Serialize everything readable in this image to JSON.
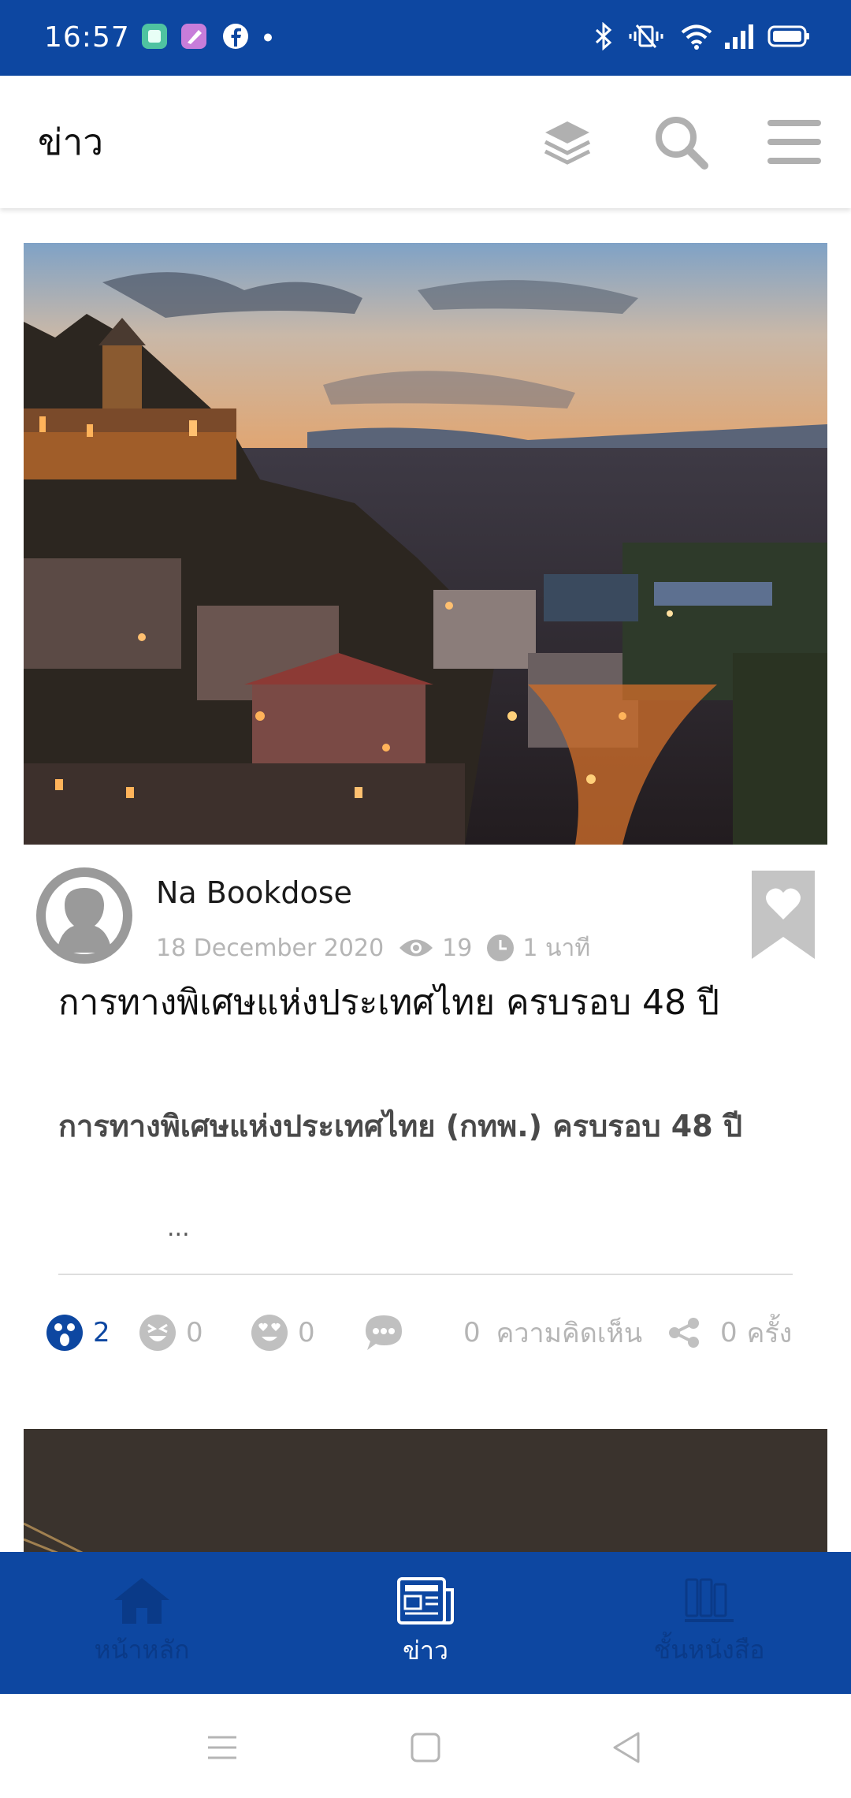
{
  "status_bar": {
    "time": "16:57",
    "icons_left": [
      "app-icon-green",
      "app-icon-pink",
      "facebook-icon",
      "dot-icon"
    ],
    "icons_right": [
      "bluetooth-icon",
      "vibrate-icon",
      "wifi-icon",
      "signal-icon",
      "battery-icon"
    ]
  },
  "app_bar": {
    "title": "ข่าว",
    "actions": [
      "layers-icon",
      "search-icon",
      "menu-icon"
    ]
  },
  "post": {
    "author": "Na Bookdose",
    "date": "18 December 2020",
    "views": "19",
    "read_time": "1 นาที",
    "headline": "การทางพิเศษแห่งประเทศไทย ครบรอบ 48 ปี",
    "subheadline": "การทางพิเศษแห่งประเทศไทย (กทพ.) ครบรอบ 48 ปี",
    "excerpt": "...",
    "reactions": [
      {
        "icon": "wow-icon",
        "count": "2",
        "active": true
      },
      {
        "icon": "laugh-icon",
        "count": "0",
        "active": false
      },
      {
        "icon": "love-icon",
        "count": "0",
        "active": false
      }
    ],
    "comments_count": "0",
    "comments_label": "ความคิดเห็น",
    "shares_count": "0",
    "shares_label": "ครั้ง"
  },
  "bottom_nav": [
    {
      "label": "หน้าหลัก",
      "icon": "home-icon",
      "active": false
    },
    {
      "label": "ข่าว",
      "icon": "news-icon",
      "active": true
    },
    {
      "label": "ชั้นหนังสือ",
      "icon": "bookshelf-icon",
      "active": false
    }
  ],
  "colors": {
    "primary": "#0d47a1",
    "muted": "#b5b5b5"
  }
}
